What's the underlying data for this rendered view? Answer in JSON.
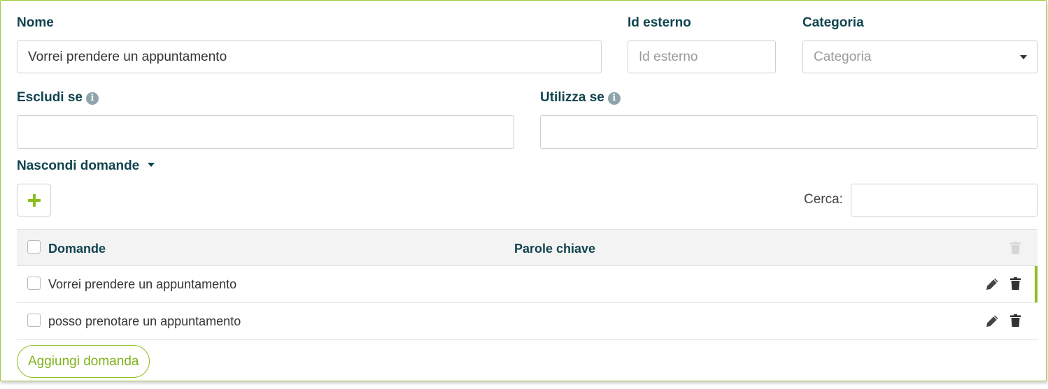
{
  "form": {
    "name": {
      "label": "Nome",
      "value": "Vorrei prendere un appuntamento"
    },
    "external_id": {
      "label": "Id esterno",
      "placeholder": "Id esterno"
    },
    "category": {
      "label": "Categoria",
      "placeholder": "Categoria"
    },
    "exclude_if": {
      "label": "Escludi se",
      "value": ""
    },
    "use_if": {
      "label": "Utilizza se",
      "value": ""
    }
  },
  "questions_toggle": {
    "label": "Nascondi domande",
    "icon": "caret-down-icon"
  },
  "toolbar": {
    "add_icon": "plus-icon",
    "search_label": "Cerca:",
    "search_value": ""
  },
  "table": {
    "columns": [
      "Domande",
      "Parole chiave"
    ],
    "header_action_icon": "trash-icon",
    "rows": [
      {
        "question": "Vorrei prendere un appuntamento",
        "keywords": "",
        "selected": true
      },
      {
        "question": "posso prenotare un appuntamento",
        "keywords": "",
        "selected": false
      }
    ]
  },
  "add_question_label": "Aggiungi domanda",
  "colors": {
    "label": "#10444f",
    "accent_green": "#8cbf1f",
    "border": "#cfcfcf",
    "header_bg": "#f3f3f3"
  }
}
